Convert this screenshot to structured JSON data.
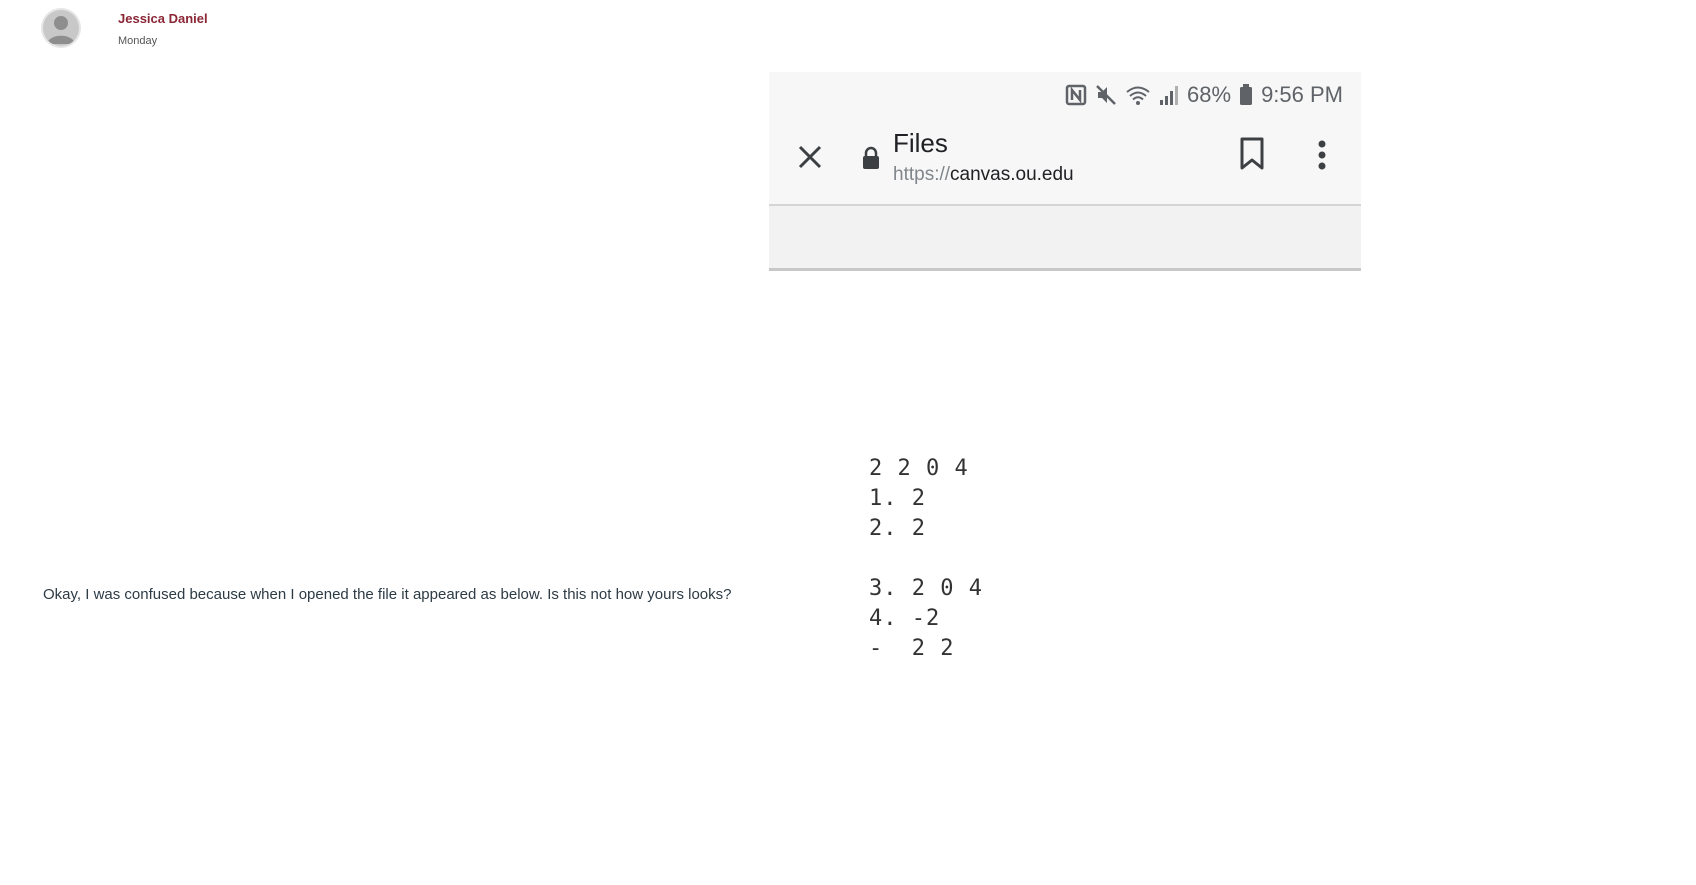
{
  "post": {
    "author": "Jessica Daniel",
    "date": "Monday",
    "message": "Okay, I was confused because when I opened the file it appeared as below. Is this not how yours looks?"
  },
  "embedded_screenshot": {
    "status_bar": {
      "battery": "68%",
      "time": "9:56 PM",
      "icons": [
        "nfc-icon",
        "mute-icon",
        "wifi-icon",
        "signal-icon",
        "battery-icon"
      ]
    },
    "toolbar": {
      "title": "Files",
      "url_scheme": "https://",
      "url_host": "canvas.ou.edu",
      "icons": [
        "close-icon",
        "lock-icon",
        "bookmark-icon",
        "more-vert-icon"
      ]
    }
  },
  "file_content": {
    "lines": [
      "2 2 0 4",
      "1. 2",
      "2. 2",
      "",
      "3. 2 0 4",
      "4. -2",
      "-  2 2"
    ]
  }
}
